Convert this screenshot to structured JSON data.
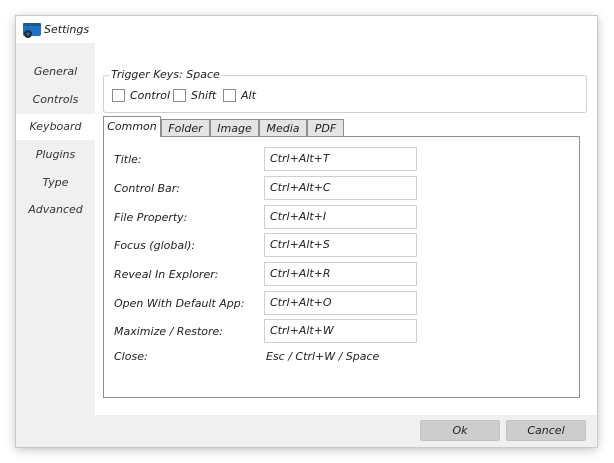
{
  "window": {
    "title": "Settings"
  },
  "sidebar": {
    "items": [
      {
        "label": "General",
        "active": false
      },
      {
        "label": "Controls",
        "active": false
      },
      {
        "label": "Keyboard",
        "active": true
      },
      {
        "label": "Plugins",
        "active": false
      },
      {
        "label": "Type",
        "active": false
      },
      {
        "label": "Advanced",
        "active": false
      }
    ]
  },
  "trigger": {
    "label": "Trigger Keys:",
    "value": "Space",
    "options": [
      {
        "label": "Control",
        "checked": false
      },
      {
        "label": "Shift",
        "checked": false
      },
      {
        "label": "Alt",
        "checked": false
      }
    ]
  },
  "tabs": [
    {
      "label": "Common",
      "active": true
    },
    {
      "label": "Folder",
      "active": false
    },
    {
      "label": "Image",
      "active": false
    },
    {
      "label": "Media",
      "active": false
    },
    {
      "label": "PDF",
      "active": false
    }
  ],
  "shortcuts": [
    {
      "label": "Title:",
      "value": "Ctrl+Alt+T",
      "editable": true
    },
    {
      "label": "Control Bar:",
      "value": "Ctrl+Alt+C",
      "editable": true
    },
    {
      "label": "File Property:",
      "value": "Ctrl+Alt+I",
      "editable": true
    },
    {
      "label": "Focus (global):",
      "value": "Ctrl+Alt+S",
      "editable": true
    },
    {
      "label": "Reveal In Explorer:",
      "value": "Ctrl+Alt+R",
      "editable": true
    },
    {
      "label": "Open With Default App:",
      "value": "Ctrl+Alt+O",
      "editable": true
    },
    {
      "label": "Maximize / Restore:",
      "value": "Ctrl+Alt+W",
      "editable": true
    },
    {
      "label": "Close:",
      "value": "Esc / Ctrl+W / Space",
      "editable": false
    }
  ],
  "footer": {
    "ok_label": "Ok",
    "cancel_label": "Cancel"
  },
  "icons": {
    "app": "app-window-icon"
  },
  "colors": {
    "sidebar_bg": "#f0f0f0",
    "footer_bg": "#f0f0f0",
    "button_bg": "#cdcdcd",
    "icon_blue": "#1e73be"
  }
}
